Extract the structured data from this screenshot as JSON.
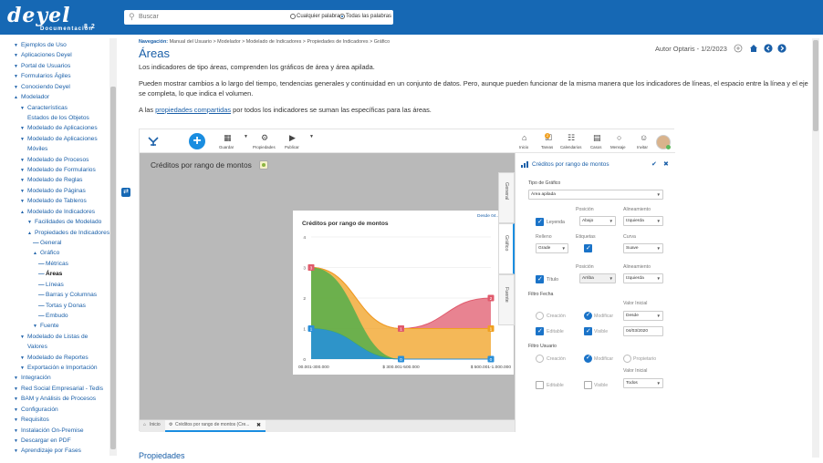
{
  "header": {
    "logo_text": "deyel",
    "logo_sub": "Documentación",
    "logo_version": "8.2",
    "search_placeholder": "Buscar",
    "opt_any": "Cualquier palabra",
    "opt_all": "Todas las palabras"
  },
  "sidebar": {
    "items": [
      {
        "label": "Ejemplos de Uso",
        "caret": "▼",
        "indent": 0
      },
      {
        "label": "Aplicaciones Deyel",
        "caret": "▼",
        "indent": 0
      },
      {
        "label": "Portal de Usuarios",
        "caret": "▼",
        "indent": 0
      },
      {
        "label": "Formularios Ágiles",
        "caret": "▼",
        "indent": 0
      },
      {
        "label": "Conociendo Deyel",
        "caret": "▼",
        "indent": 0
      },
      {
        "label": "Modelador",
        "caret": "▲",
        "indent": 0
      },
      {
        "label": "Características",
        "caret": "▼",
        "indent": 1
      },
      {
        "label": "Estados de los Objetos",
        "caret": "",
        "indent": 1
      },
      {
        "label": "Modelado de Aplicaciones",
        "caret": "▼",
        "indent": 1
      },
      {
        "label": "Modelado de Aplicaciones",
        "caret": "▼",
        "indent": 1
      },
      {
        "label": "Móviles",
        "caret": "",
        "indent": 1
      },
      {
        "label": "Modelado de Procesos",
        "caret": "▼",
        "indent": 1
      },
      {
        "label": "Modelado de Formularios",
        "caret": "▼",
        "indent": 1
      },
      {
        "label": "Modelado de Reglas",
        "caret": "▼",
        "indent": 1
      },
      {
        "label": "Modelado de Páginas",
        "caret": "▼",
        "indent": 1
      },
      {
        "label": "Modelado de Tableros",
        "caret": "▼",
        "indent": 1
      },
      {
        "label": "Modelado de Indicadores",
        "caret": "▲",
        "indent": 1
      },
      {
        "label": "Facilidades de Modelado",
        "caret": "▼",
        "indent": 2
      },
      {
        "label": "Propiedades de Indicadores",
        "caret": "▲",
        "indent": 2
      },
      {
        "label": "General",
        "caret": "—",
        "indent": 3
      },
      {
        "label": "Gráfico",
        "caret": "▲",
        "indent": 3
      },
      {
        "label": "Métricas",
        "caret": "—",
        "indent": 4
      },
      {
        "label": "Áreas",
        "caret": "—",
        "indent": 4,
        "active": true
      },
      {
        "label": "Líneas",
        "caret": "—",
        "indent": 4
      },
      {
        "label": "Barras y Columnas",
        "caret": "—",
        "indent": 4
      },
      {
        "label": "Tortas y Donas",
        "caret": "—",
        "indent": 4
      },
      {
        "label": "Embudo",
        "caret": "—",
        "indent": 4
      },
      {
        "label": "Fuente",
        "caret": "▼",
        "indent": 3
      },
      {
        "label": "Modelado de Listas de",
        "caret": "▼",
        "indent": 1
      },
      {
        "label": "Valores",
        "caret": "",
        "indent": 1
      },
      {
        "label": "Modelado de Reportes",
        "caret": "▼",
        "indent": 1
      },
      {
        "label": "Exportación e Importación",
        "caret": "▼",
        "indent": 1
      },
      {
        "label": "Integración",
        "caret": "▼",
        "indent": 0
      },
      {
        "label": "Red Social Empresarial - Tedis",
        "caret": "▼",
        "indent": 0
      },
      {
        "label": "BAM y Análisis de Procesos",
        "caret": "▼",
        "indent": 0
      },
      {
        "label": "Configuración",
        "caret": "▼",
        "indent": 0
      },
      {
        "label": "Requisitos",
        "caret": "▼",
        "indent": 0
      },
      {
        "label": "Instalación On-Premise",
        "caret": "▼",
        "indent": 0
      },
      {
        "label": "Descargar en PDF",
        "caret": "▼",
        "indent": 0
      },
      {
        "label": "Aprendizaje por Fases",
        "caret": "▼",
        "indent": 0
      }
    ]
  },
  "content": {
    "breadcrumb_label": "Navegación:",
    "breadcrumb": "Manual del Usuario > Modelador > Modelado de Indicadores > Propiedades de Indicadores > Gráfico",
    "title": "Áreas",
    "author": "Autor Optaris - 1/2/2023",
    "p1": "Los indicadores de tipo áreas, comprenden los gráficos de área y área apilada.",
    "p2": "Pueden mostrar cambios a lo largo del tiempo, tendencias generales y continuidad en un conjunto de datos. Pero, aunque pueden funcionar de la misma manera que los indicadores de líneas, el espacio entre la línea y el eje se completa, lo que indica el volumen.",
    "p3_pre": "A las ",
    "p3_link": "propiedades compartidas",
    "p3_post": " por todos los indicadores se suman las específicas para las áreas.",
    "section_title": "Propiedades"
  },
  "app": {
    "toolbar": {
      "save": "Guardar",
      "props": "Propiedades",
      "publish": "Publicar",
      "home": "Inicio",
      "tasks": "Tareas",
      "calendars": "Calendarios",
      "cases": "Casos",
      "message": "Mensaje",
      "invite": "Invitar",
      "badge": "2"
    },
    "canvas_title": "Créditos por rango de montos",
    "tabs": {
      "home": "Inicio",
      "active": "Créditos por rango de montos (Cre..."
    },
    "side_tabs": {
      "general": "General",
      "grafico": "Gráfico",
      "fuente": "Fuente"
    },
    "props": {
      "title": "Créditos por rango de montos",
      "tipo_label": "Tipo de Gráfico",
      "tipo_value": "Área apilada",
      "posicion": "Posición",
      "alineamiento": "Alineamiento",
      "leyenda": "Leyenda",
      "leyenda_pos": "Abajo",
      "leyenda_align": "Izquierda",
      "relleno": "Relleno",
      "relleno_val": "Grade",
      "etiquetas": "Etiquetas",
      "curva": "Curva",
      "curva_val": "Suave",
      "posicion2": "Posición",
      "alineamiento2": "Alineamiento",
      "titulo": "Título",
      "titulo_pos": "Arriba",
      "titulo_align": "Izquierda",
      "filtro_fecha": "Filtro Fecha",
      "valor_inicial": "Valor Inicial",
      "creacion": "Creación",
      "modificar": "Modificar",
      "desde": "Desde",
      "editable": "Editable",
      "visible": "Visible",
      "fecha": "04/03/2020",
      "filtro_usuario": "Filtro Usuario",
      "creacion2": "Creación",
      "modificar2": "Modificar",
      "propietario": "Propietario",
      "valor_inicial2": "Valor Inicial",
      "editable2": "Editable",
      "visible2": "Visible",
      "todos": "Todos"
    }
  },
  "chart_data": {
    "type": "area",
    "stacked": true,
    "title": "Créditos por rango de montos",
    "legend_hint": "Desde 04...",
    "categories": [
      "00.001-300.000",
      "$ 300.001-500.000",
      "$ 500.001-1.000.000"
    ],
    "ylim": [
      0,
      4
    ],
    "yticks": [
      0,
      1,
      2,
      3,
      4
    ],
    "series": [
      {
        "values": [
          1,
          0,
          0
        ],
        "color": "#2a8fd8"
      },
      {
        "values": [
          2,
          1,
          1
        ],
        "color": "#f0a020"
      },
      {
        "values": [
          0,
          0,
          1
        ],
        "color": "#e05a6c"
      }
    ],
    "labels_per_series": [
      [
        "1",
        "0",
        "0"
      ],
      [
        "3",
        "1",
        "1"
      ],
      [
        "3",
        "1",
        "2"
      ]
    ],
    "green_overlay": [
      3,
      0,
      0
    ]
  }
}
